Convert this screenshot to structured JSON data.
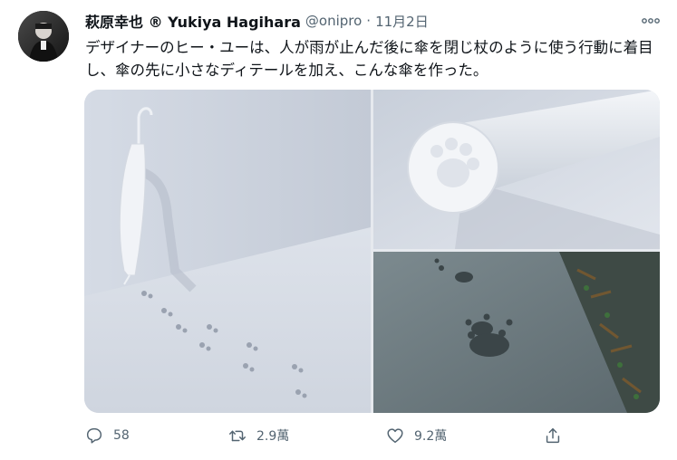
{
  "user": {
    "name": "萩原幸也 ® Yukiya Hagihara",
    "handle": "@onipro",
    "separator": "·",
    "date": "11月2日"
  },
  "tweet": {
    "text": "デザイナーのヒー・ユーは、人が雨が止んだ後に傘を閉じ杖のように使う行動に着目し、傘の先に小さなディテールを加え、こんな傘を作った。"
  },
  "actions": {
    "reply_count": "58",
    "retweet_count": "2.9萬",
    "like_count": "9.2萬"
  },
  "icons": {
    "more": "more-icon",
    "reply": "reply-icon",
    "retweet": "retweet-icon",
    "like": "like-icon",
    "share": "share-icon"
  },
  "colors": {
    "text_primary": "#0f1419",
    "text_secondary": "#536471"
  }
}
